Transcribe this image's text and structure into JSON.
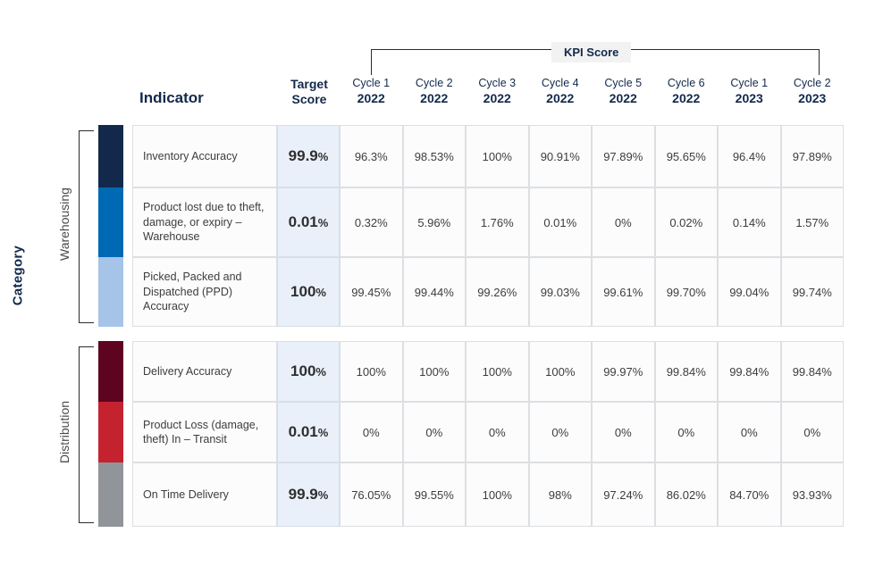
{
  "axis": {
    "category_label": "Category",
    "groups": [
      {
        "name": "Warehousing"
      },
      {
        "name": "Distribution"
      }
    ]
  },
  "header": {
    "indicator_label": "Indicator",
    "target_label_line1": "Target",
    "target_label_line2": "Score",
    "kpi_group_label": "KPI Score",
    "cycles": [
      {
        "cycle": "Cycle 1",
        "year": "2022"
      },
      {
        "cycle": "Cycle 2",
        "year": "2022"
      },
      {
        "cycle": "Cycle 3",
        "year": "2022"
      },
      {
        "cycle": "Cycle 4",
        "year": "2022"
      },
      {
        "cycle": "Cycle 5",
        "year": "2022"
      },
      {
        "cycle": "Cycle 6",
        "year": "2022"
      },
      {
        "cycle": "Cycle 1",
        "year": "2023"
      },
      {
        "cycle": "Cycle 2",
        "year": "2023"
      }
    ]
  },
  "colors": {
    "warehousing": [
      "#12294b",
      "#0069b4",
      "#a6c3e8"
    ],
    "distribution": [
      "#5e0320",
      "#c4222f",
      "#919499"
    ],
    "target_col_bg": "#e9f0f9",
    "cell_bg": "#fcfcfc",
    "grid": "#dcdfe3",
    "navy_text": "#12294b",
    "chip_bg": "#f2f2f2"
  },
  "chart_data": {
    "type": "table",
    "title": "KPI Score",
    "columns": [
      "Indicator",
      "Target Score",
      "Cycle 1 2022",
      "Cycle 2 2022",
      "Cycle 3 2022",
      "Cycle 4 2022",
      "Cycle 5 2022",
      "Cycle 6 2022",
      "Cycle 1 2023",
      "Cycle 2 2023"
    ],
    "groups": [
      {
        "name": "Warehousing",
        "rows": [
          {
            "swatch": "#12294b",
            "indicator": "Inventory Accuracy",
            "target_num": "99.9",
            "target_pct": "%",
            "values": [
              "96.3%",
              "98.53%",
              "100%",
              "90.91%",
              "97.89%",
              "95.65%",
              "96.4%",
              "97.89%"
            ]
          },
          {
            "swatch": "#0069b4",
            "indicator": "Product lost due to theft, damage, or expiry – Warehouse",
            "target_num": "0.01",
            "target_pct": "%",
            "values": [
              "0.32%",
              "5.96%",
              "1.76%",
              "0.01%",
              "0%",
              "0.02%",
              "0.14%",
              "1.57%"
            ]
          },
          {
            "swatch": "#a6c3e8",
            "indicator": "Picked, Packed and Dispatched (PPD) Accuracy",
            "target_num": "100",
            "target_pct": "%",
            "values": [
              "99.45%",
              "99.44%",
              "99.26%",
              "99.03%",
              "99.61%",
              "99.70%",
              "99.04%",
              "99.74%"
            ]
          }
        ]
      },
      {
        "name": "Distribution",
        "rows": [
          {
            "swatch": "#5e0320",
            "indicator": "Delivery Accuracy",
            "target_num": "100",
            "target_pct": "%",
            "values": [
              "100%",
              "100%",
              "100%",
              "100%",
              "99.97%",
              "99.84%",
              "99.84%",
              "99.84%"
            ]
          },
          {
            "swatch": "#c4222f",
            "indicator": "Product Loss (damage, theft) In – Transit",
            "target_num": "0.01",
            "target_pct": "%",
            "values": [
              "0%",
              "0%",
              "0%",
              "0%",
              "0%",
              "0%",
              "0%",
              "0%"
            ]
          },
          {
            "swatch": "#919499",
            "indicator": "On Time Delivery",
            "target_num": "99.9",
            "target_pct": "%",
            "values": [
              "76.05%",
              "99.55%",
              "100%",
              "98%",
              "97.24%",
              "86.02%",
              "84.70%",
              "93.93%"
            ]
          }
        ]
      }
    ]
  }
}
